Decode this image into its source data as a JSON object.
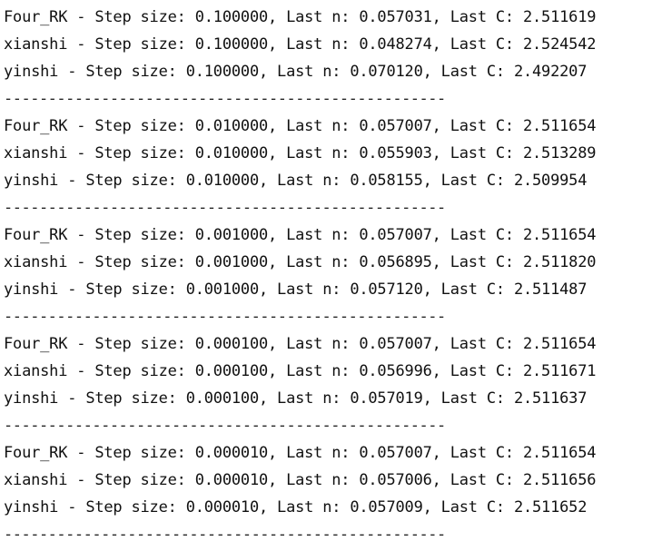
{
  "console": {
    "blocks": [
      {
        "lines": [
          "Four_RK - Step size: 0.100000, Last n: 0.057031, Last C: 2.511619",
          "xianshi - Step size: 0.100000, Last n: 0.048274, Last C: 2.524542",
          "yinshi - Step size: 0.100000, Last n: 0.070120, Last C: 2.492207"
        ],
        "separator": "--------------------------------------------------"
      },
      {
        "lines": [
          "Four_RK - Step size: 0.010000, Last n: 0.057007, Last C: 2.511654",
          "xianshi - Step size: 0.010000, Last n: 0.055903, Last C: 2.513289",
          "yinshi - Step size: 0.010000, Last n: 0.058155, Last C: 2.509954"
        ],
        "separator": "--------------------------------------------------"
      },
      {
        "lines": [
          "Four_RK - Step size: 0.001000, Last n: 0.057007, Last C: 2.511654",
          "xianshi - Step size: 0.001000, Last n: 0.056895, Last C: 2.511820",
          "yinshi - Step size: 0.001000, Last n: 0.057120, Last C: 2.511487"
        ],
        "separator": "--------------------------------------------------"
      },
      {
        "lines": [
          "Four_RK - Step size: 0.000100, Last n: 0.057007, Last C: 2.511654",
          "xianshi - Step size: 0.000100, Last n: 0.056996, Last C: 2.511671",
          "yinshi - Step size: 0.000100, Last n: 0.057019, Last C: 2.511637"
        ],
        "separator": "--------------------------------------------------"
      },
      {
        "lines": [
          "Four_RK - Step size: 0.000010, Last n: 0.057007, Last C: 2.511654",
          "xianshi - Step size: 0.000010, Last n: 0.057006, Last C: 2.511656",
          "yinshi - Step size: 0.000010, Last n: 0.057009, Last C: 2.511652"
        ],
        "separator": "--------------------------------------------------"
      }
    ]
  }
}
